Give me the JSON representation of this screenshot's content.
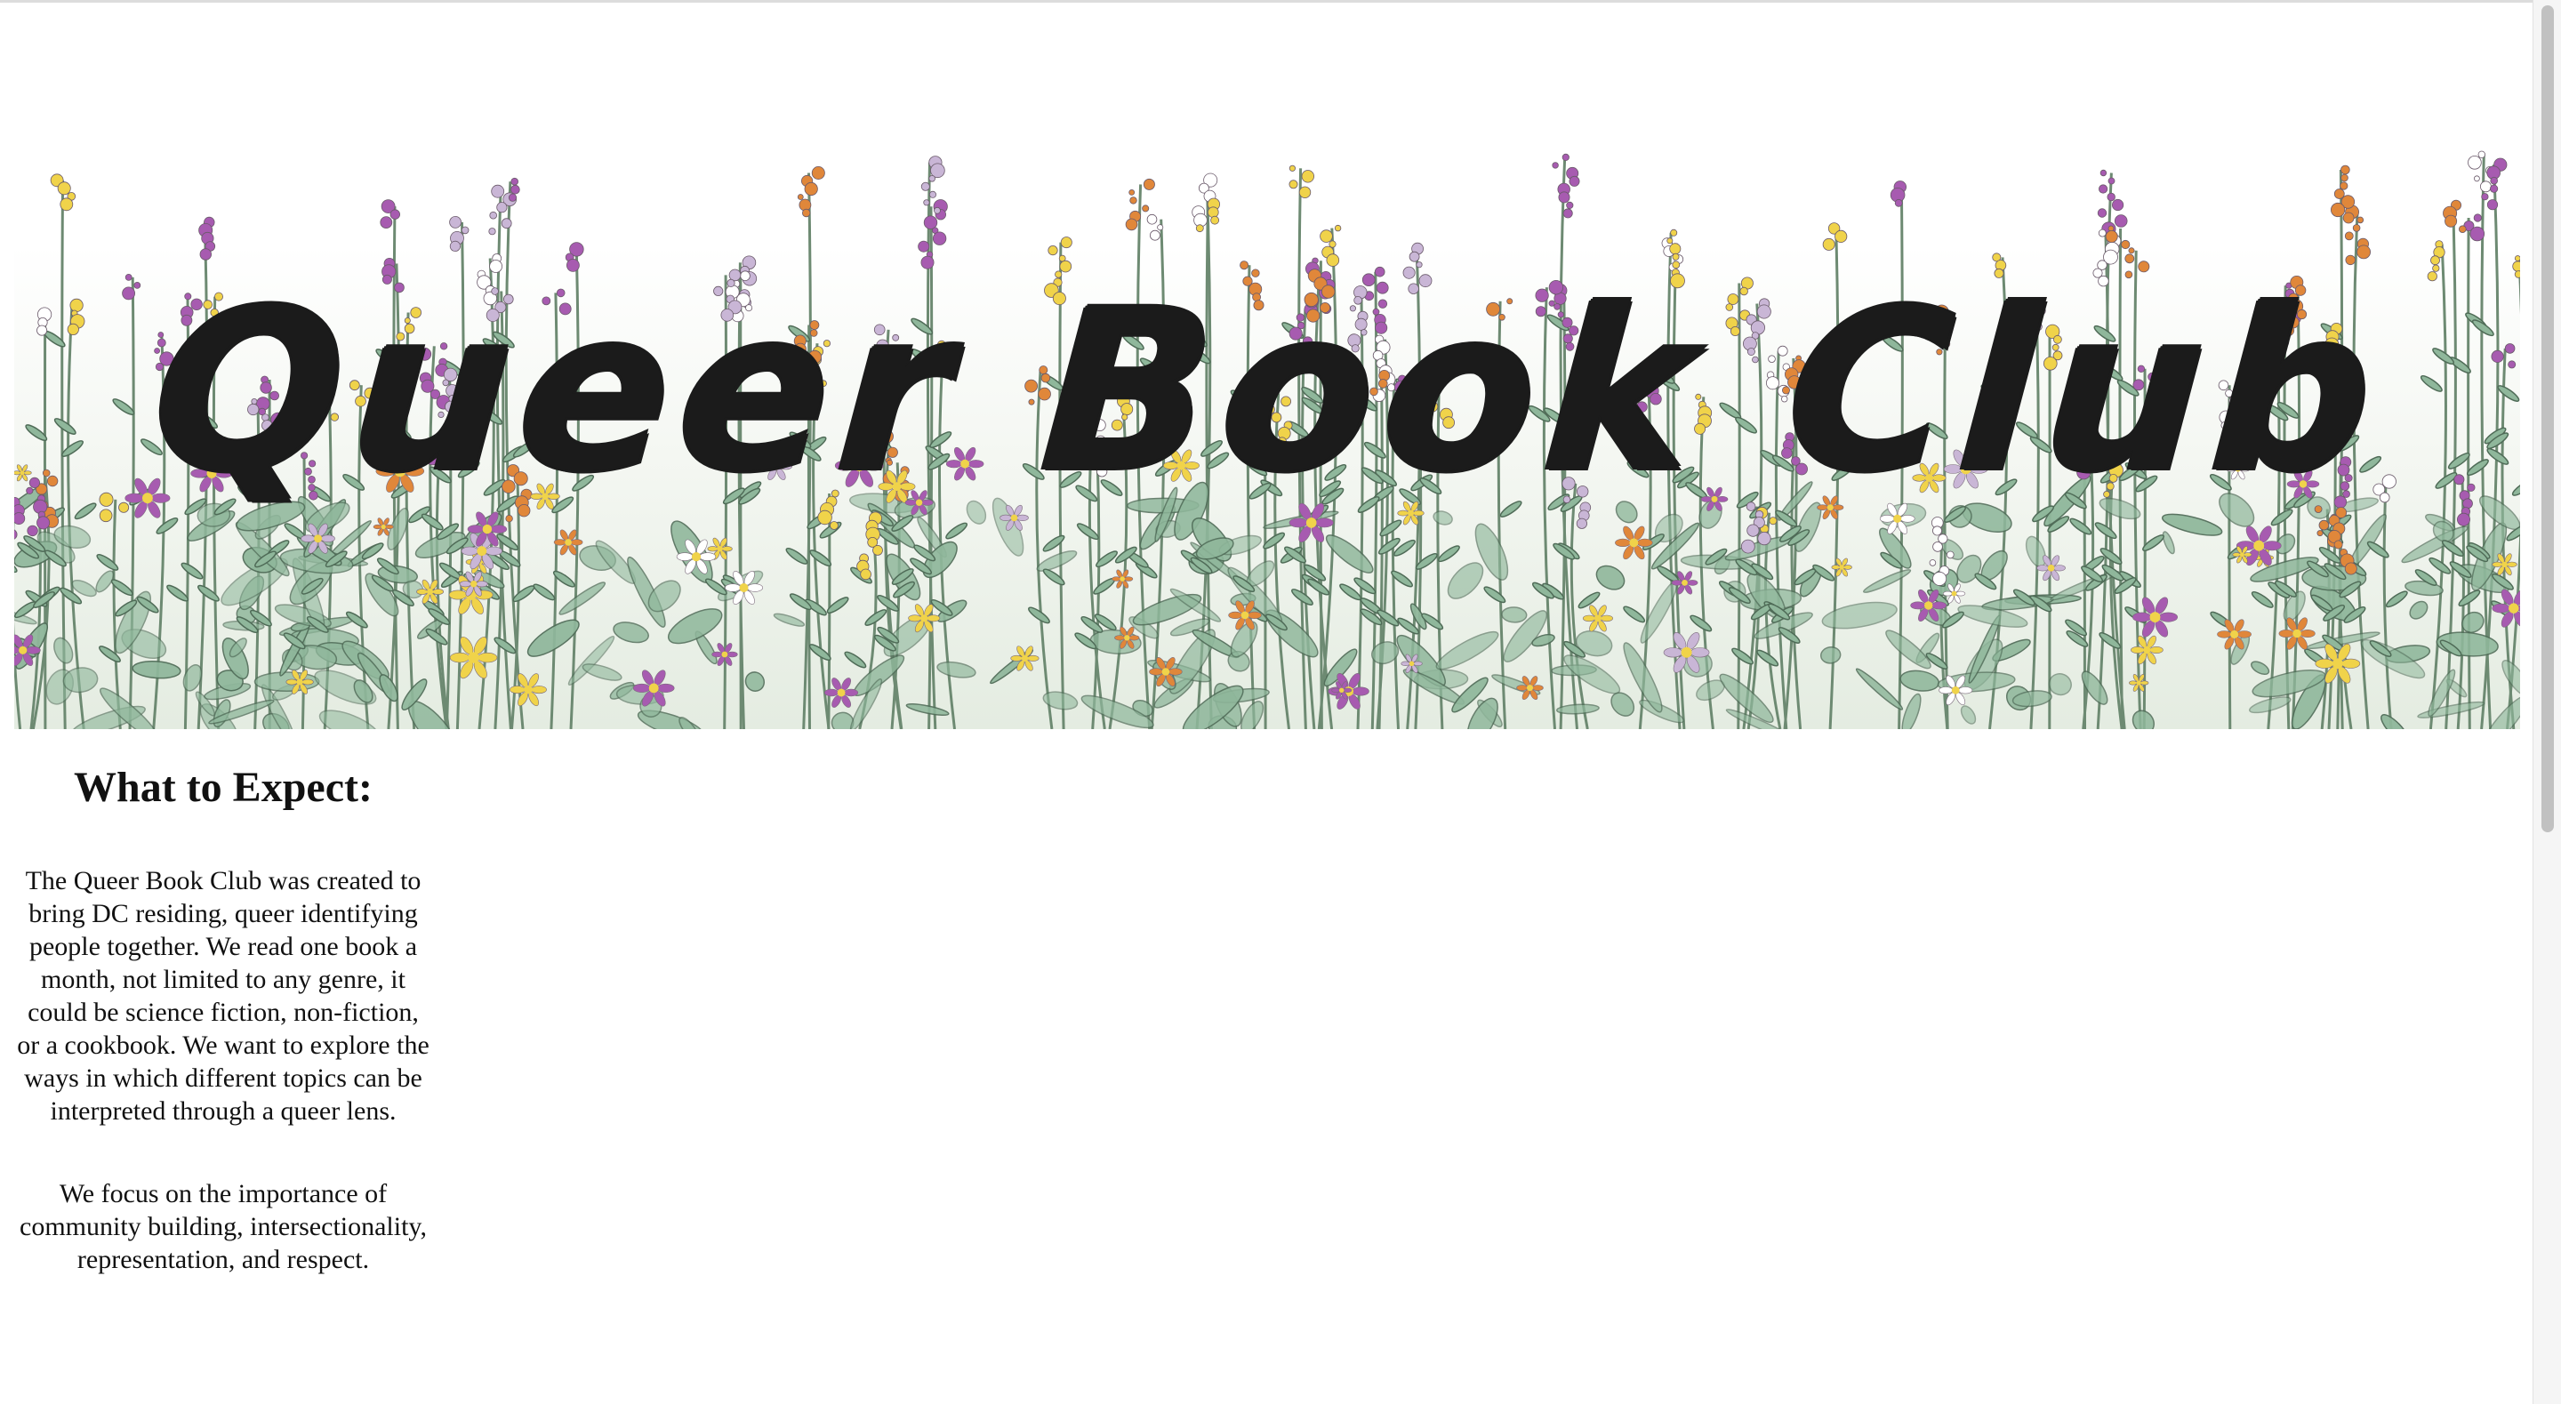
{
  "banner": {
    "title": "Queer Book Club",
    "image": "wildflower-meadow-illustration"
  },
  "about": {
    "heading": "What to Expect:",
    "paragraph_1": "The Queer Book Club was created to bring DC residing, queer identifying people together. We read one book a month, not limited to any genre, it could be science fiction, non-fiction, or a cookbook. We want to explore the ways in which different topics can be interpreted through a queer lens.",
    "paragraph_2": "We focus on the importance of community building, intersectionality, representation, and respect."
  },
  "colors": {
    "title": "#1b1b1b",
    "leaf": "#8fb79b",
    "stem": "#6d8a72",
    "purple": "#a75bb0",
    "orange": "#e0873a",
    "yellow": "#f0d34a",
    "lavender": "#c9b6d6"
  },
  "scrollbar": {
    "visible": true
  }
}
